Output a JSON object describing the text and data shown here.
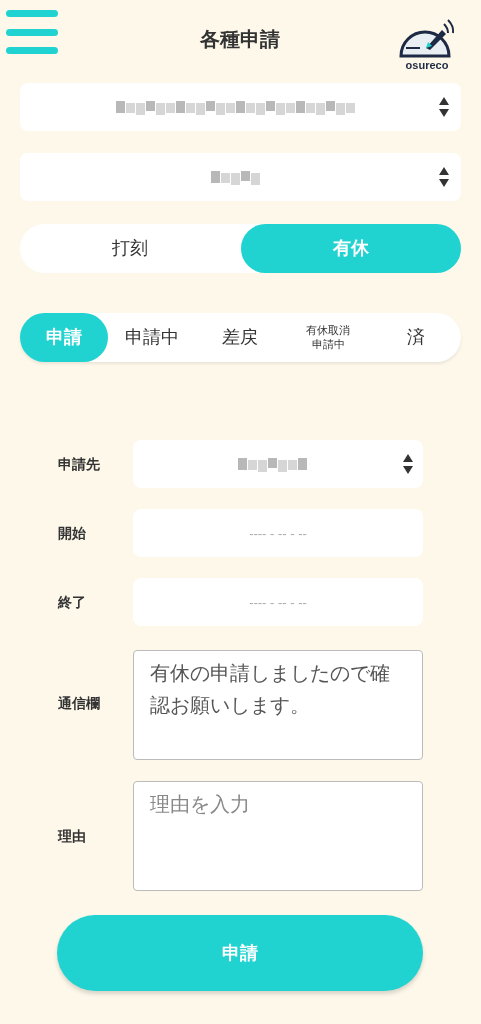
{
  "header": {
    "title": "各種申請",
    "logo_text": "osureco"
  },
  "selects": [
    {
      "kind": "redacted"
    },
    {
      "kind": "redacted"
    }
  ],
  "mode_toggle": [
    {
      "label": "打刻",
      "selected": false
    },
    {
      "label": "有休",
      "selected": true
    }
  ],
  "status_tabs": [
    {
      "label": "申請",
      "selected": true
    },
    {
      "label": "申請中",
      "selected": false
    },
    {
      "label": "差戻",
      "selected": false
    },
    {
      "lines": [
        "有休取消",
        "申請中"
      ],
      "selected": false
    },
    {
      "label": "済",
      "selected": false
    }
  ],
  "form": [
    {
      "kind": "select",
      "label": "申請先"
    },
    {
      "kind": "date",
      "label": "開始",
      "placeholder": "---- - -- - --"
    },
    {
      "kind": "date",
      "label": "終了",
      "placeholder": "---- - -- - --"
    },
    {
      "kind": "textarea",
      "label": "通信欄",
      "value": "有休の申請しましたので確認お願いします。"
    },
    {
      "kind": "textarea",
      "label": "理由",
      "placeholder": "理由を入力"
    }
  ],
  "submit": "申請"
}
